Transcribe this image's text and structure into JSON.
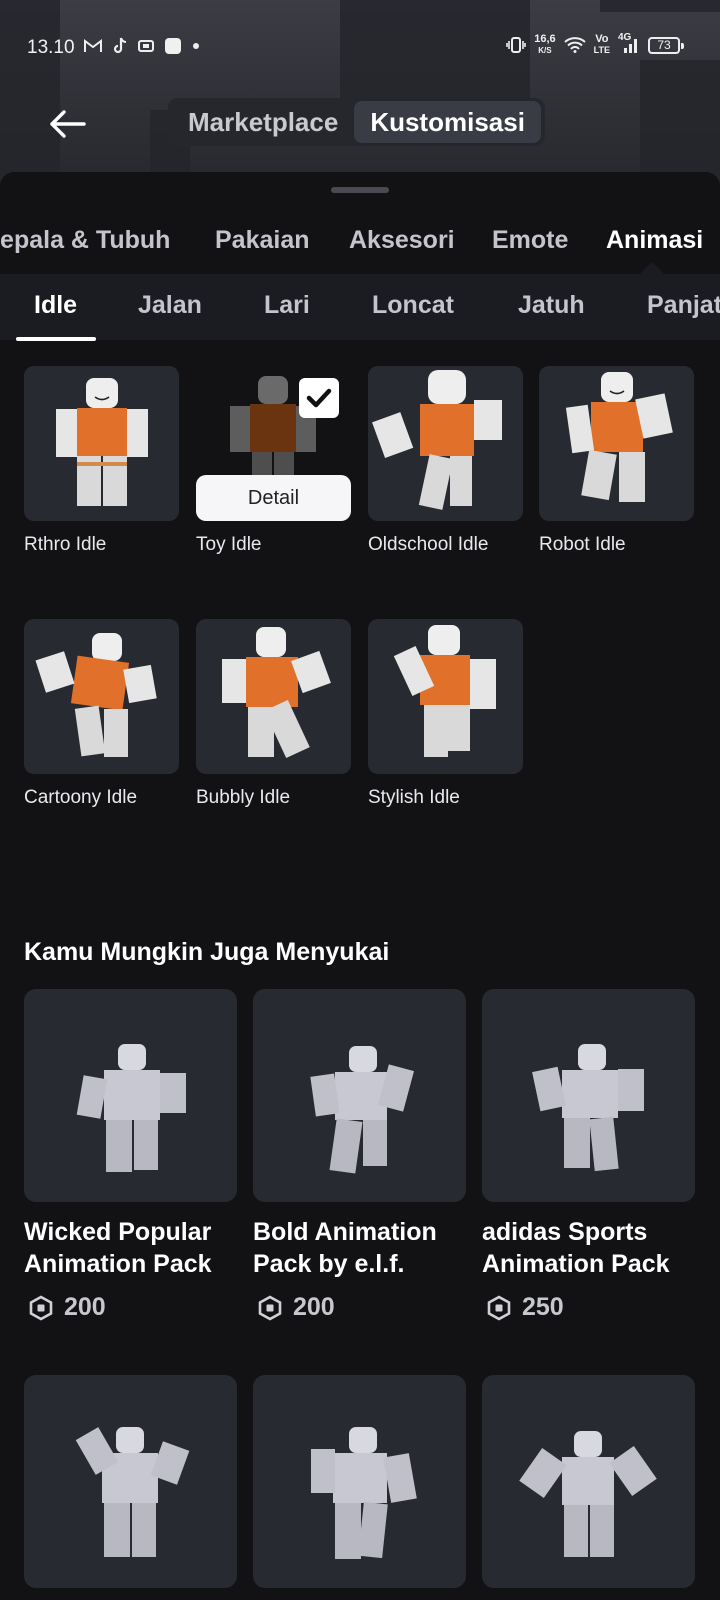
{
  "status_bar": {
    "time": "13.10",
    "net_speed_value": "16,6",
    "net_speed_unit": "K/S",
    "volte_top": "Vo",
    "volte_bottom": "LTE",
    "network": "4G",
    "battery": "73"
  },
  "header": {
    "tabs": [
      {
        "label": "Marketplace",
        "active": false
      },
      {
        "label": "Kustomisasi",
        "active": true
      }
    ]
  },
  "categories": [
    {
      "label": "Kepala & Tubuh",
      "active": false
    },
    {
      "label": "Pakaian",
      "active": false
    },
    {
      "label": "Aksesori",
      "active": false
    },
    {
      "label": "Emote",
      "active": false
    },
    {
      "label": "Animasi",
      "active": true
    }
  ],
  "subcategories": [
    {
      "label": "Idle",
      "active": true
    },
    {
      "label": "Jalan",
      "active": false
    },
    {
      "label": "Lari",
      "active": false
    },
    {
      "label": "Loncat",
      "active": false
    },
    {
      "label": "Jatuh",
      "active": false
    },
    {
      "label": "Panjat",
      "active": false
    }
  ],
  "items": [
    {
      "name": "Rthro Idle",
      "equipped": false
    },
    {
      "name": "Toy Idle",
      "equipped": true
    },
    {
      "name": "Oldschool Idle",
      "equipped": false
    },
    {
      "name": "Robot Idle",
      "equipped": false
    },
    {
      "name": "Cartoony Idle",
      "equipped": false
    },
    {
      "name": "Bubbly Idle",
      "equipped": false
    },
    {
      "name": "Stylish Idle",
      "equipped": false
    }
  ],
  "detail_button": "Detail",
  "recommend": {
    "title": "Kamu Mungkin Juga Menyukai",
    "items": [
      {
        "name_line1": "Wicked Popular",
        "name_line2": "Animation Pack",
        "price": "200"
      },
      {
        "name_line1": "Bold Animation",
        "name_line2": "Pack by e.l.f.",
        "price": "200"
      },
      {
        "name_line1": "adidas Sports",
        "name_line2": "Animation Pack",
        "price": "250"
      }
    ]
  },
  "colors": {
    "background": "#121215",
    "tile": "#282a31",
    "shirt_orange": "#e0702a",
    "accent_white": "#ffffff"
  }
}
